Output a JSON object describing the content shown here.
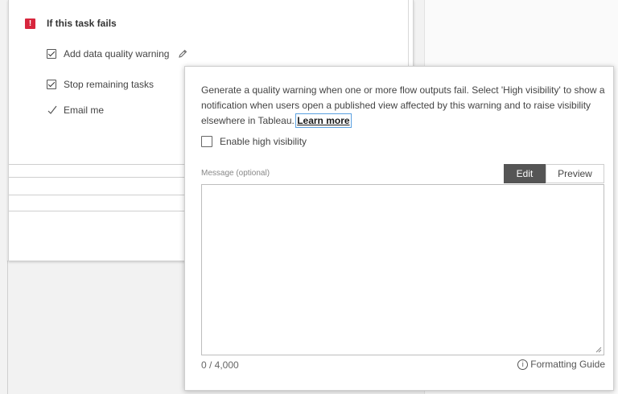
{
  "failure_section": {
    "title": "If this task fails",
    "options": [
      {
        "label": "Add data quality warning",
        "checked": true
      },
      {
        "label": "Stop remaining tasks",
        "checked": true
      },
      {
        "label": "Email me",
        "checked": true
      }
    ]
  },
  "popover": {
    "description": "Generate a quality warning when one or more flow outputs fail. Select 'High visibility' to show a notification when users open a published view affected by this warning and to raise visibility elsewhere in Tableau.",
    "learn_more": "Learn more",
    "high_visibility_label": "Enable high visibility",
    "high_visibility_checked": false,
    "message_label": "Message (optional)",
    "tabs": [
      {
        "label": "Edit",
        "active": true
      },
      {
        "label": "Preview",
        "active": false
      }
    ],
    "message_value": "",
    "char_count": "0 / 4,000",
    "formatting_guide": "Formatting Guide"
  },
  "colors": {
    "alert": "#d7263d",
    "active_tab": "#555555",
    "link_focus": "#5aa0e0"
  },
  "icons": [
    "alert-icon",
    "pencil-icon",
    "checkmark-icon",
    "info-icon",
    "resize-handle-icon"
  ]
}
